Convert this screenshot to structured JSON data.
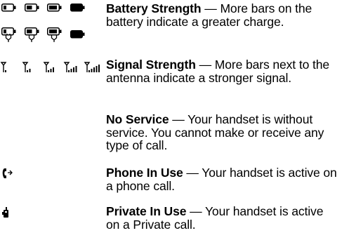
{
  "entries": [
    {
      "icon_names": [
        "battery-1-bar-icon",
        "battery-2-bar-icon",
        "battery-3-bar-icon",
        "battery-full-icon",
        "battery-charging-1-icon",
        "battery-charging-2-icon",
        "battery-charging-3-icon",
        "battery-charging-full-icon"
      ],
      "title": "Battery Strength",
      "dash": " — ",
      "text": "More bars on the battery indicate a greater charge."
    },
    {
      "icon_names": [
        "signal-1-bar-icon",
        "signal-2-bar-icon",
        "signal-3-bar-icon",
        "signal-4-bar-icon",
        "signal-5-bar-icon"
      ],
      "title": "Signal Strength",
      "dash": " — ",
      "text": "More bars next to the antenna indicate a stronger signal."
    },
    {
      "icon_names": [],
      "title": "No Service",
      "dash": " — ",
      "text": "Your handset is without service. You cannot make or receive any type of call."
    },
    {
      "icon_names": [
        "phone-in-use-icon"
      ],
      "title": "Phone In Use",
      "dash": " — ",
      "text": "Your handset is active on a phone call."
    },
    {
      "icon_names": [
        "private-in-use-icon"
      ],
      "title": "Private In Use",
      "dash": " — ",
      "text": "Your handset is active on a Private call."
    }
  ]
}
